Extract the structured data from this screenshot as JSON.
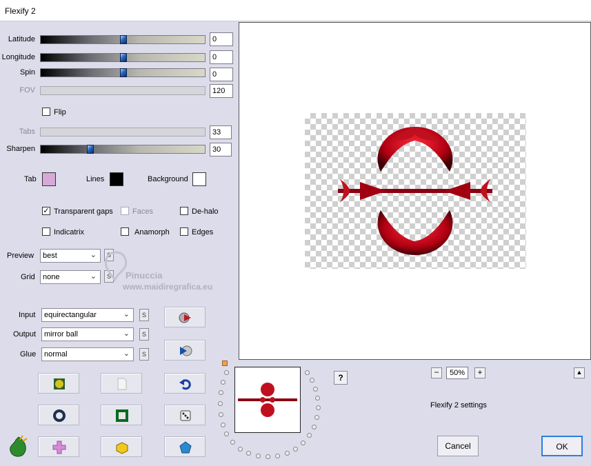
{
  "window": {
    "title": "Flexify 2"
  },
  "sliders": [
    {
      "label": "Latitude",
      "value": "0",
      "enabled": true,
      "level": 0.5
    },
    {
      "label": "Longitude",
      "value": "0",
      "enabled": true,
      "level": 0.5
    },
    {
      "label": "Spin",
      "value": "0",
      "enabled": true,
      "level": 0.5
    },
    {
      "label": "FOV",
      "value": "120",
      "enabled": false,
      "level": 0
    },
    {
      "label": "Tabs",
      "value": "33",
      "enabled": false,
      "level": 0
    },
    {
      "label": "Sharpen",
      "value": "30",
      "enabled": true,
      "level": 0.3
    }
  ],
  "flip": {
    "label": "Flip",
    "checked": false
  },
  "colors": {
    "tab": {
      "label": "Tab",
      "color": "#d7a8d8"
    },
    "lines": {
      "label": "Lines",
      "color": "#000000"
    },
    "background": {
      "label": "Background",
      "color": "#ffffff"
    }
  },
  "options": {
    "transparent_gaps": {
      "label": "Transparent gaps",
      "checked": true
    },
    "faces": {
      "label": "Faces",
      "checked": false,
      "enabled": false
    },
    "de_halo": {
      "label": "De-halo",
      "checked": false
    },
    "indicatrix": {
      "label": "Indicatrix",
      "checked": false
    },
    "anamorph": {
      "label": "Anamorph",
      "checked": false
    },
    "edges": {
      "label": "Edges",
      "checked": false
    }
  },
  "preview_select": {
    "label": "Preview",
    "value": "best",
    "s": "S"
  },
  "grid_select": {
    "label": "Grid",
    "value": "none",
    "s": "S"
  },
  "input_select": {
    "label": "Input",
    "value": "equirectangular",
    "s": "S"
  },
  "output_select": {
    "label": "Output",
    "value": "mirror ball",
    "s": "S"
  },
  "glue_select": {
    "label": "Glue",
    "value": "normal",
    "s": "S"
  },
  "watermark": {
    "line1": "Pinuccia",
    "line2": "www.maidiregrafica.eu"
  },
  "zoom": {
    "minus": "−",
    "value": "50%",
    "plus": "+"
  },
  "help": "?",
  "scroll_up": "▲",
  "settings_label": "Flexify 2 settings",
  "buttons": {
    "cancel": "Cancel",
    "ok": "OK"
  },
  "accent_color": "#2b7de0"
}
